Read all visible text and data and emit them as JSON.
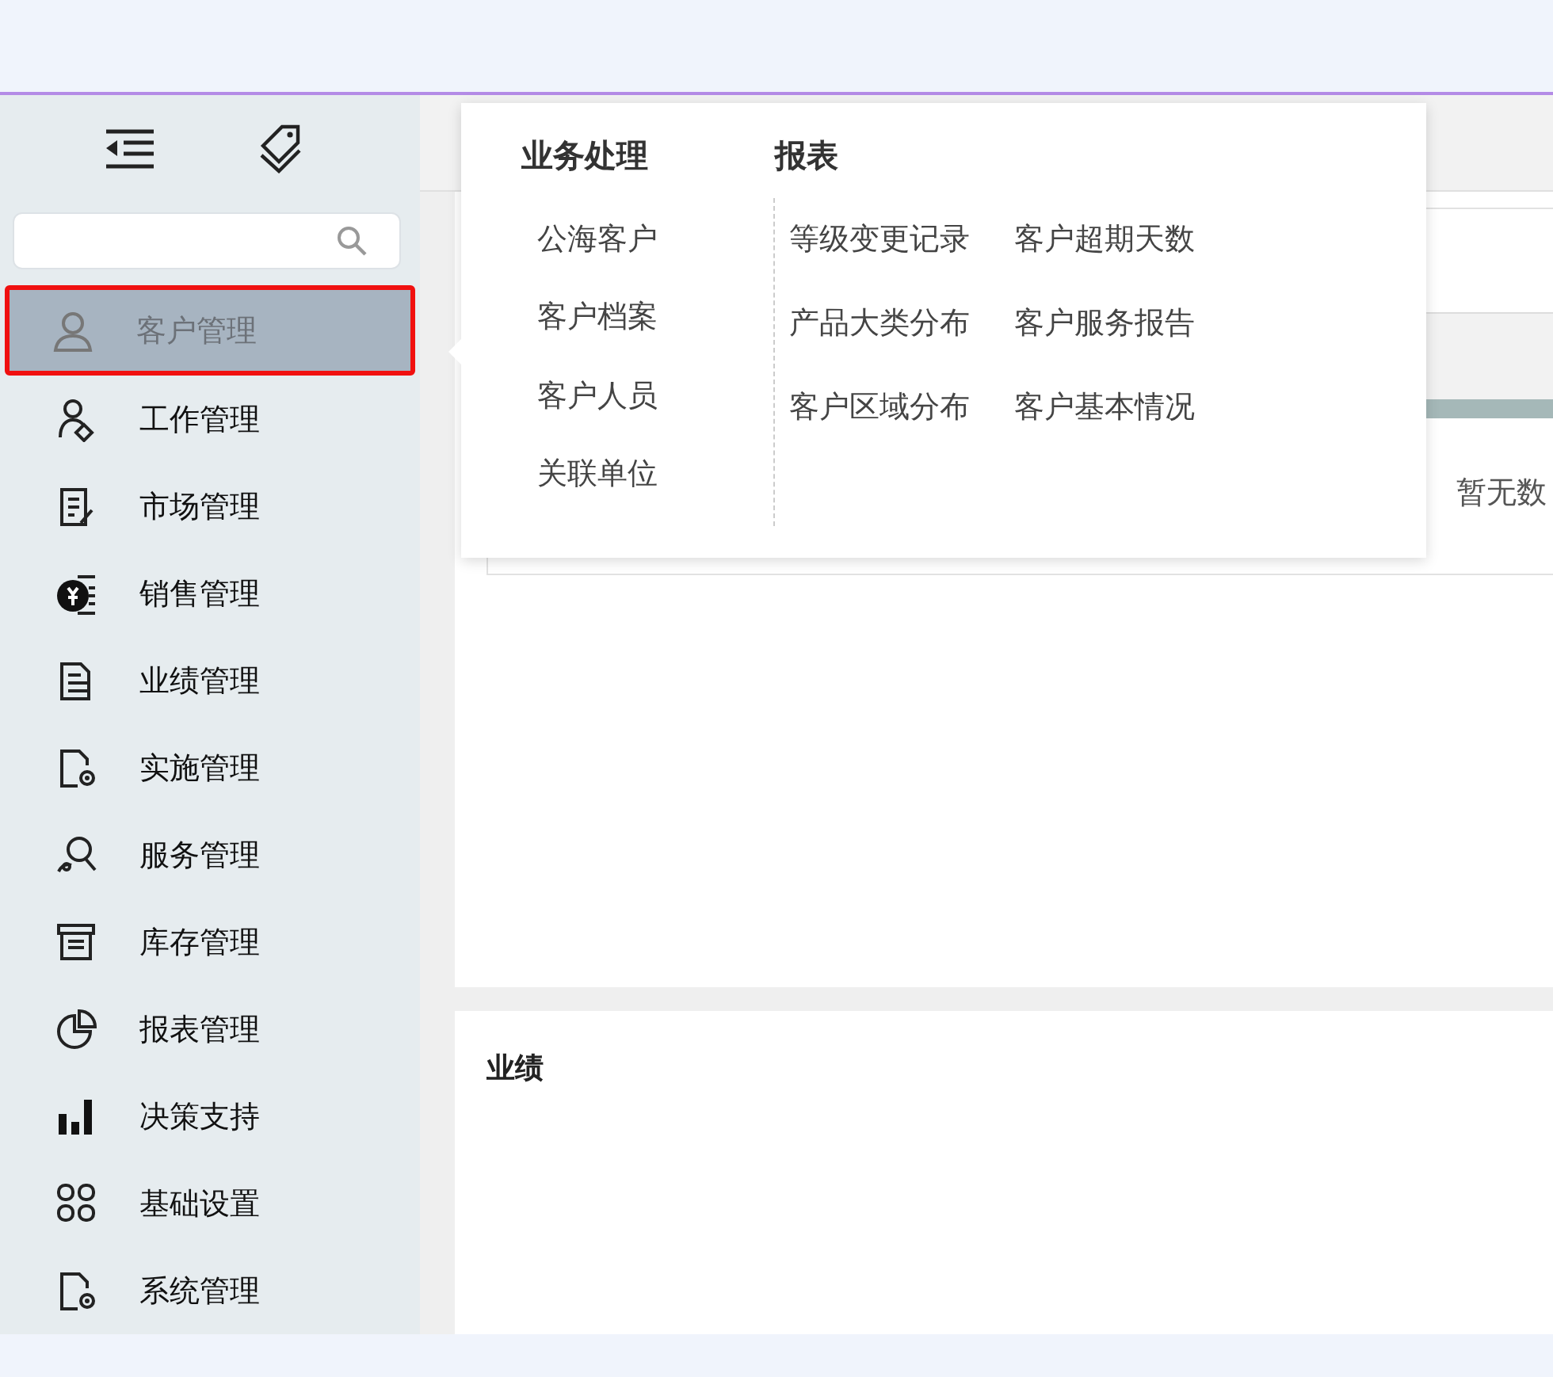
{
  "sidebar": {
    "menu": [
      {
        "label": "客户管理",
        "selected": true
      },
      {
        "label": "工作管理",
        "selected": false
      },
      {
        "label": "市场管理",
        "selected": false
      },
      {
        "label": "销售管理",
        "selected": false
      },
      {
        "label": "业绩管理",
        "selected": false
      },
      {
        "label": "实施管理",
        "selected": false
      },
      {
        "label": "服务管理",
        "selected": false
      },
      {
        "label": "库存管理",
        "selected": false
      },
      {
        "label": "报表管理",
        "selected": false
      },
      {
        "label": "决策支持",
        "selected": false
      },
      {
        "label": "基础设置",
        "selected": false
      },
      {
        "label": "系统管理",
        "selected": false
      }
    ]
  },
  "flyout": {
    "groups": [
      {
        "title": "业务处理",
        "items": [
          "公海客户",
          "客户档案",
          "客户人员",
          "关联单位"
        ]
      },
      {
        "title": "报表",
        "items": [
          "等级变更记录",
          "客户超期天数",
          "产品大类分布",
          "客户服务报告",
          "客户区域分布",
          "客户基本情况"
        ]
      }
    ]
  },
  "overview_card": {
    "empty_text": "暂无数"
  },
  "performance_card": {
    "title": "业绩"
  }
}
